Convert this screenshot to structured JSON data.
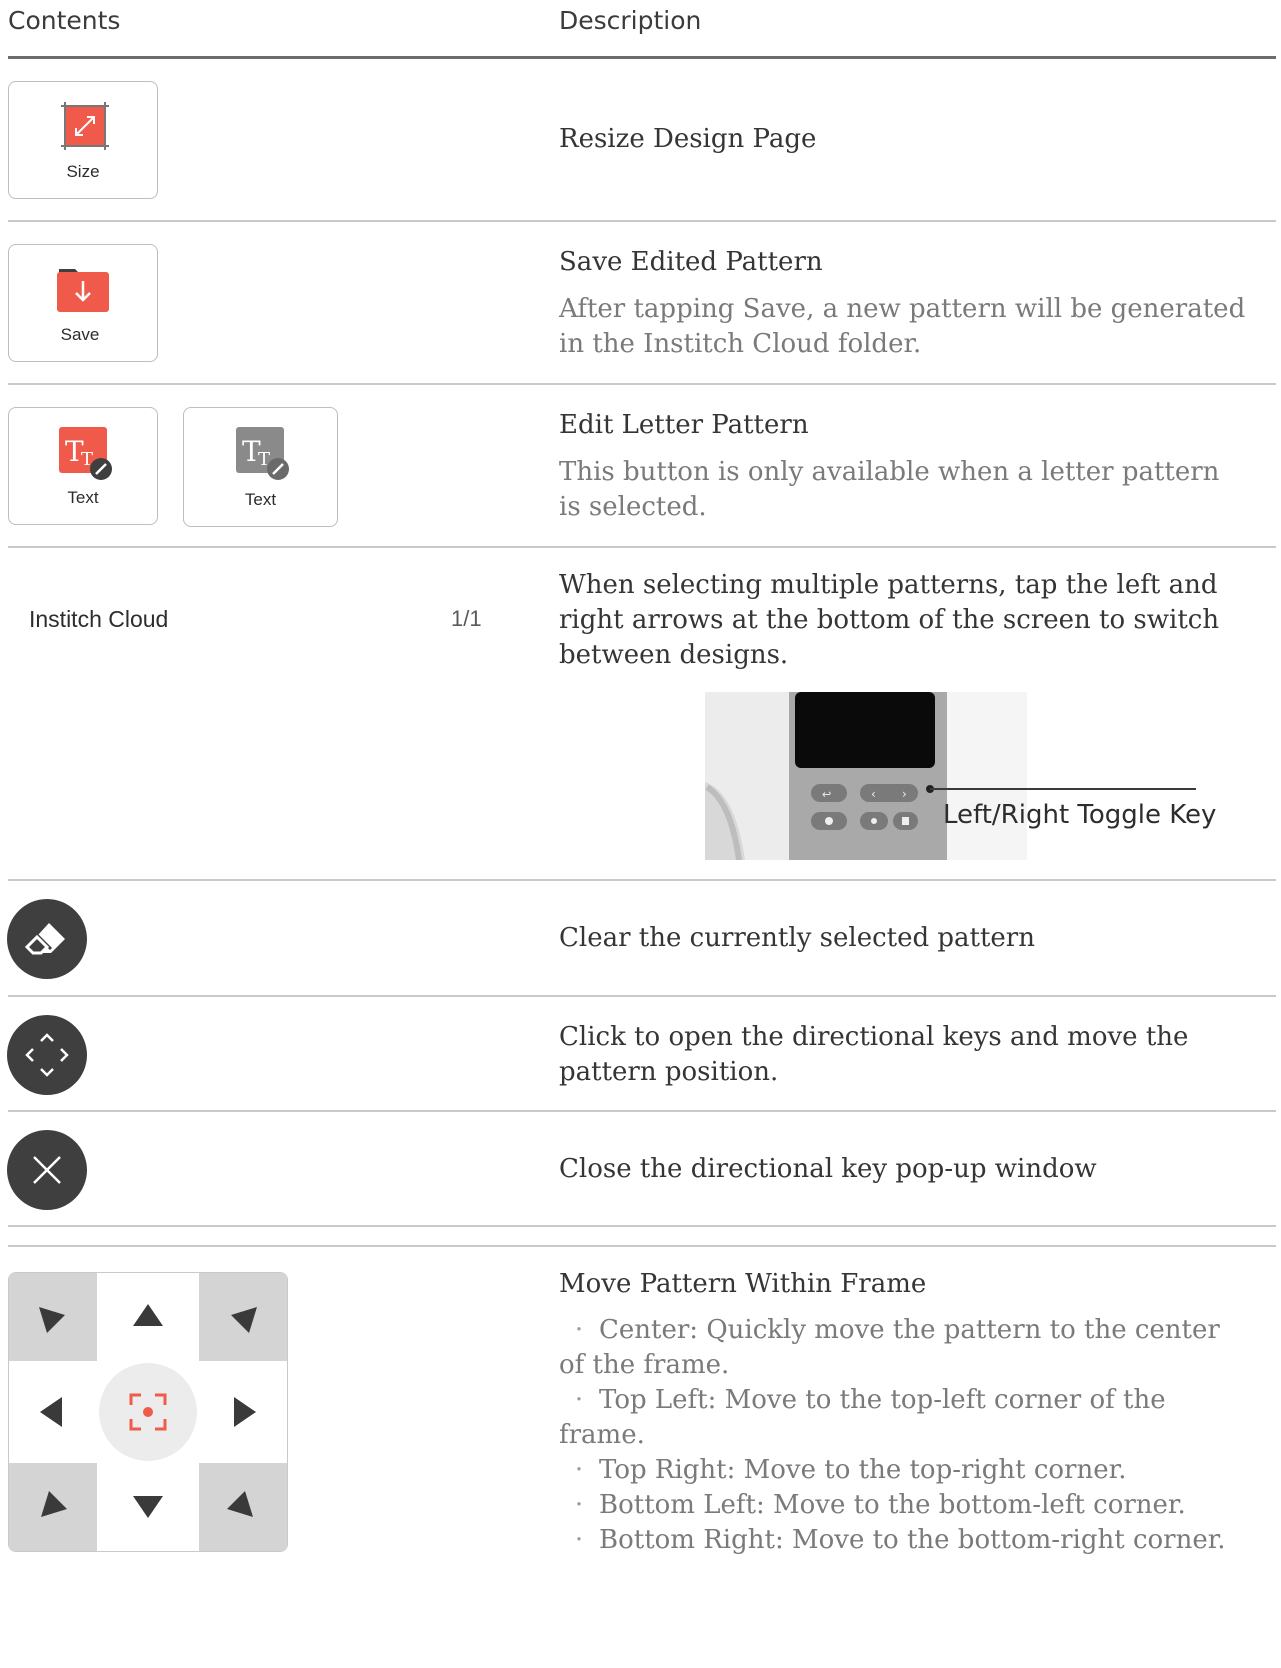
{
  "header": {
    "contents_label": "Contents",
    "description_label": "Description"
  },
  "colors": {
    "accent": "#ef5a4b",
    "dark_icon": "#3f3f3f",
    "gray_icon": "#8a8a8a",
    "rule": "#c9c9c9"
  },
  "rows": {
    "size": {
      "button_label": "Size",
      "icon": "resize-icon",
      "title": "Resize Design Page"
    },
    "save": {
      "button_label": "Save",
      "icon": "save-folder-icon",
      "title": "Save Edited Pattern",
      "desc_lines": [
        "After tapping Save, a new pattern will be generated",
        "in the Institch Cloud folder."
      ]
    },
    "text": {
      "button_label_active": "Text",
      "button_label_disabled": "Text",
      "icon": "text-edit-icon",
      "title": "Edit Letter Pattern",
      "desc_lines": [
        "This button is only available when a letter pattern",
        "is selected."
      ]
    },
    "cloud": {
      "name": "Institch Cloud",
      "counter": "1/1",
      "desc_lines": [
        "When selecting multiple patterns, tap the left and",
        "right arrows at the bottom of the screen to switch",
        "between designs."
      ],
      "callout": "Left/Right Toggle Key"
    },
    "clear": {
      "icon": "eraser-icon",
      "title": "Clear the currently selected pattern"
    },
    "move": {
      "icon": "move-arrows-icon",
      "desc_lines": [
        "Click to open the directional keys and move the",
        "pattern position."
      ]
    },
    "close": {
      "icon": "close-icon",
      "title": "Close the directional key pop-up window"
    },
    "frame": {
      "title": "Move Pattern Within Frame",
      "bullet": "·",
      "bullets": [
        {
          "lines": [
            "Center: Quickly move the pattern to the center",
            "of the frame."
          ]
        },
        {
          "lines": [
            "Top Left: Move to the top-left corner of the",
            "frame."
          ]
        },
        {
          "lines": [
            "Top Right: Move to the top-right corner."
          ]
        },
        {
          "lines": [
            "Bottom Left: Move to the bottom-left corner."
          ]
        },
        {
          "lines": [
            "Bottom Right: Move to the bottom-right corner."
          ]
        }
      ]
    }
  }
}
